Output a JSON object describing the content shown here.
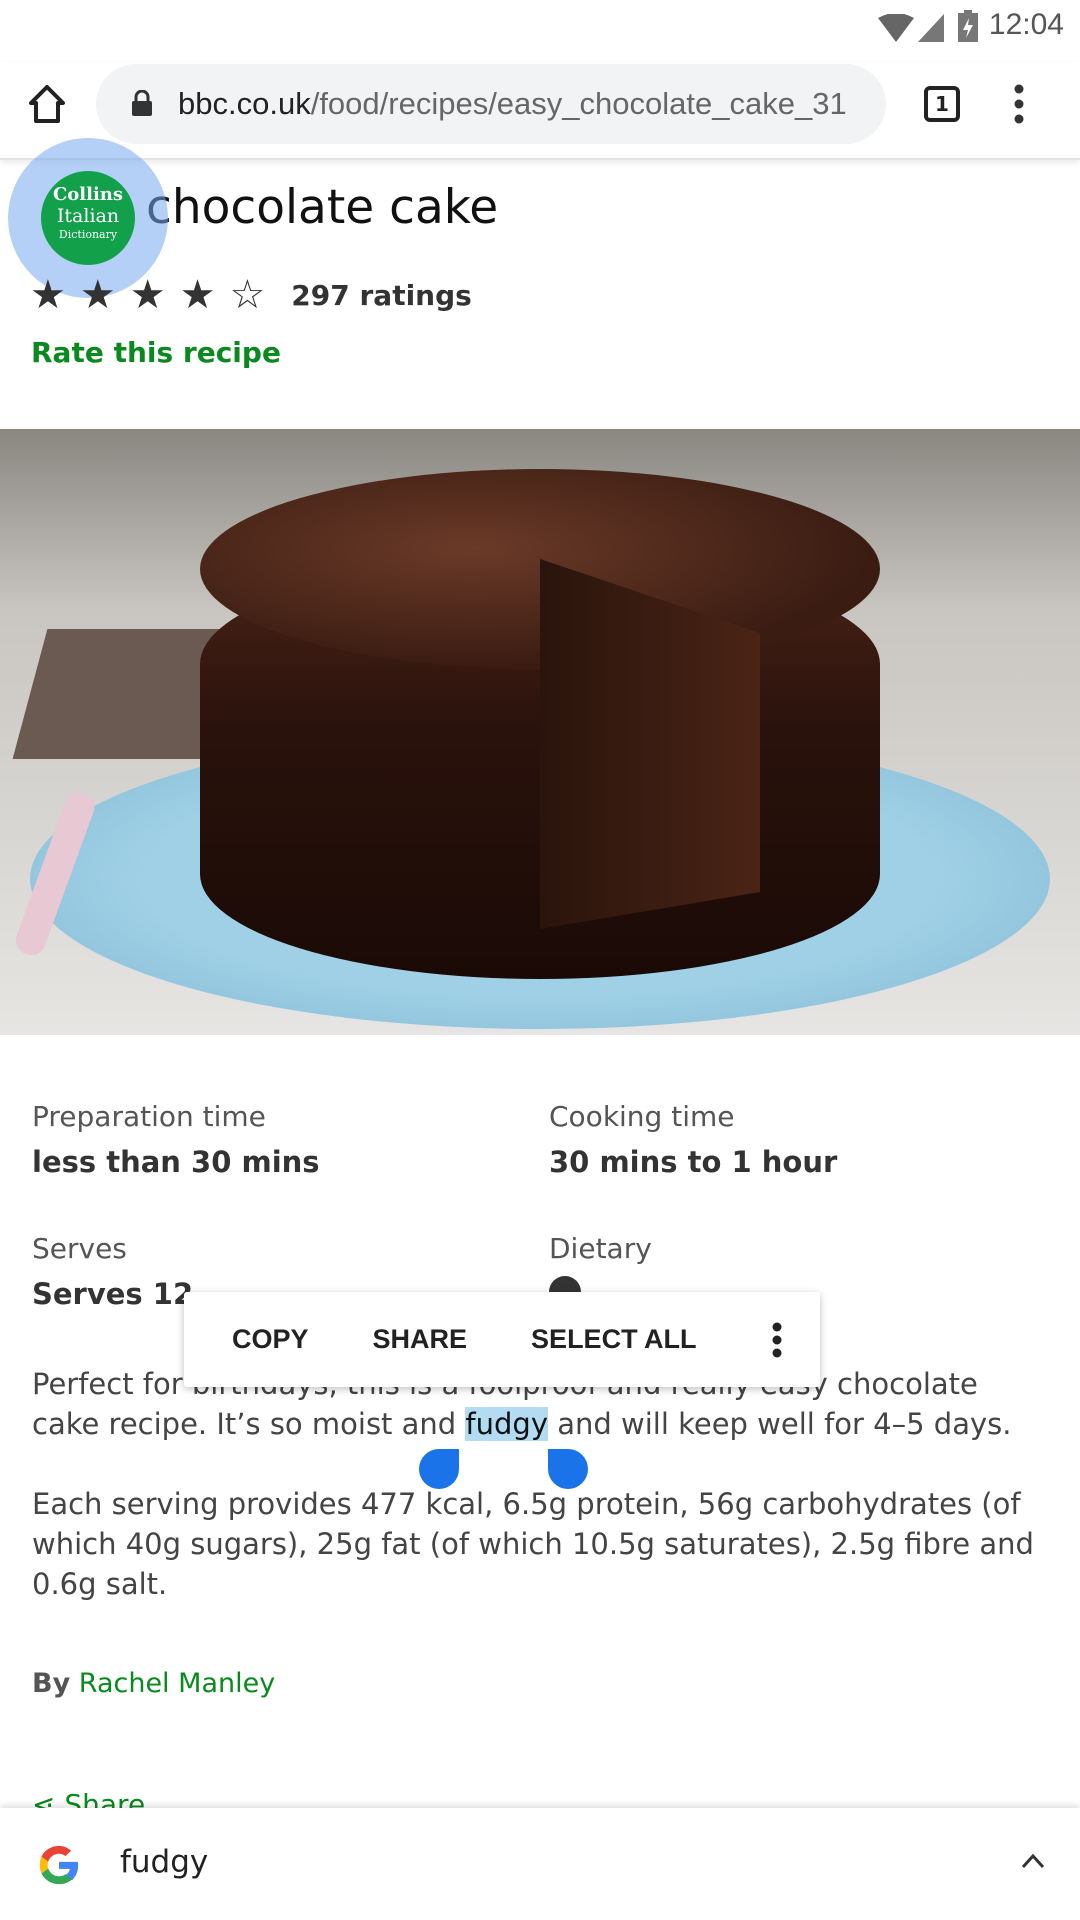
{
  "status_bar": {
    "time": "12:04",
    "icons": [
      "wifi-icon",
      "signal-icon",
      "battery-charging-icon"
    ]
  },
  "browser": {
    "url_domain": "bbc.co.uk",
    "url_path": "/food/recipes/easy_chocolate_cake_31",
    "tab_count": "1"
  },
  "overlay": {
    "bubble_line1": "Collins",
    "bubble_line2": "Italian",
    "bubble_line3": "Dictionary"
  },
  "recipe": {
    "title": "Easy chocolate cake",
    "title_visible": "chocolate cake",
    "rating": 4,
    "rating_max": 5,
    "ratings_count": "297 ratings",
    "rate_link": "Rate this recipe",
    "prep_label": "Preparation time",
    "prep_value": "less than 30 mins",
    "cook_label": "Cooking time",
    "cook_value": "30 mins to 1 hour",
    "serves_label": "Serves",
    "serves_value": "Serves 12",
    "dietary_label": "Dietary",
    "dietary_icon": "vegetarian-icon",
    "desc_line1": "Perfect for birthdays, this is a foolproof and really easy chocolate",
    "desc_line2_pre": "cake recipe. It’s so moist and ",
    "desc_selected": "fudgy",
    "desc_line2_post": " and will keep well for 4–5 days.",
    "nutrition": [
      "Each serving provides 477 kcal, 6.5g protein, 56g carbohydrates (of",
      "which 40g sugars), 25g fat (of which 10.5g saturates), 2.5g fibre and",
      "0.6g salt."
    ],
    "by_label": "By",
    "author": "Rachel Manley",
    "share": "Share"
  },
  "context_menu": {
    "copy": "COPY",
    "share": "SHARE",
    "select_all": "SELECT ALL"
  },
  "search_bar": {
    "query": "fudgy"
  },
  "colors": {
    "accent_green": "#0a8a1e",
    "selection": "#b3dcf3",
    "handle": "#1a73e8"
  }
}
